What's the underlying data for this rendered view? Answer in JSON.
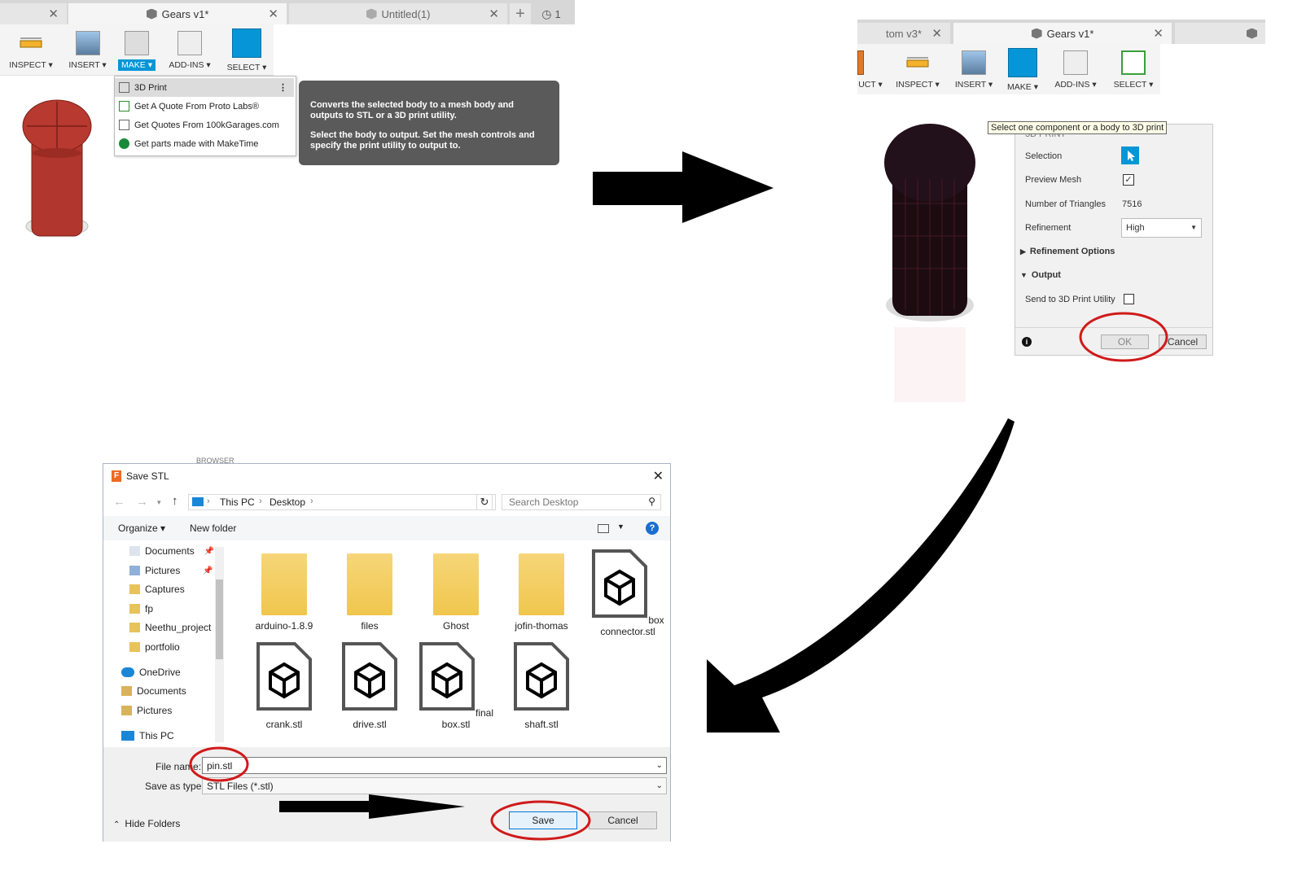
{
  "panel1": {
    "tabs": [
      {
        "label": ""
      },
      {
        "label": "Gears v1*"
      },
      {
        "label": "Untitled(1)"
      }
    ],
    "job_count": "1",
    "toolbar": [
      "INSPECT ▾",
      "INSERT ▾",
      "MAKE ▾",
      "ADD-INS ▾",
      "SELECT ▾"
    ],
    "menu_items": [
      "3D Print",
      "Get A Quote From Proto Labs®",
      "Get Quotes From 100kGarages.com",
      "Get parts made with MakeTime"
    ],
    "tooltip_lines": [
      "Converts the selected body to a mesh body and outputs to STL or a 3D print utility.",
      "Select the body to output. Set the mesh controls and specify the print utility to output to."
    ]
  },
  "panel2": {
    "tabs": [
      {
        "label": "tom v3*"
      },
      {
        "label": "Gears v1*"
      }
    ],
    "toolbar": [
      "UCT ▾",
      "INSPECT ▾",
      "INSERT ▾",
      "MAKE ▾",
      "ADD-INS ▾",
      "SELECT ▾"
    ],
    "tooltip": "Select one component or a body to 3D print",
    "dialog": {
      "title": "3D PRINT",
      "selection_label": "Selection",
      "preview_label": "Preview Mesh",
      "triangles_label": "Number of Triangles",
      "triangles_value": "7516",
      "refinement_label": "Refinement",
      "refinement_value": "High",
      "refinement_options": "Refinement Options",
      "output": "Output",
      "send_label": "Send to 3D Print Utility",
      "ok": "OK",
      "cancel": "Cancel"
    }
  },
  "panel3": {
    "browser_strip": "BROWSER",
    "title": "Save STL",
    "breadcrumb": [
      "This PC",
      "Desktop"
    ],
    "search_placeholder": "Search Desktop",
    "organize": "Organize ▾",
    "new_folder": "New folder",
    "nav": [
      "Documents",
      "Pictures",
      "Captures",
      "fp",
      "Neethu_project",
      "portfolio",
      "OneDrive",
      "Documents",
      "Pictures",
      "This PC"
    ],
    "folders": [
      "arduino-1.8.9",
      "files",
      "Ghost",
      "jofin-thomas"
    ],
    "stl_files": [
      "box connector.stl",
      "crank.stl",
      "drive.stl",
      "final box.stl",
      "shaft.stl"
    ],
    "file_name_label": "File name:",
    "file_name_value": "pin.stl",
    "save_type_label": "Save as type:",
    "save_type_value": "STL Files (*.stl)",
    "hide_folders": "Hide Folders",
    "save": "Save",
    "cancel": "Cancel"
  },
  "colors": {
    "accent": "#0696d7",
    "annotation": "#d01a1a",
    "part": "#b0362e",
    "tooltip_bg": "#5a5a5a"
  }
}
